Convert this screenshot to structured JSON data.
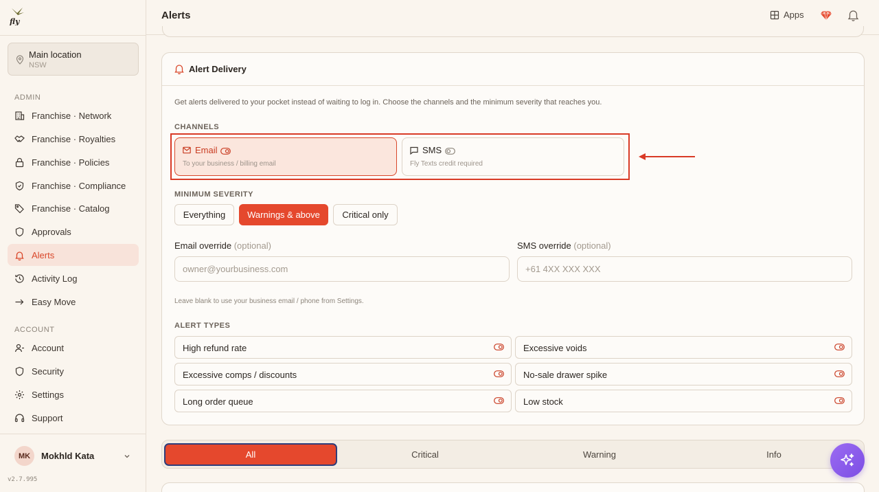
{
  "sidebar": {
    "location": {
      "name": "Main location",
      "region": "NSW"
    },
    "admin_label": "ADMIN",
    "admin_items": [
      {
        "label": "Franchise · Network",
        "icon": "building-icon"
      },
      {
        "label": "Franchise · Royalties",
        "icon": "handshake-icon"
      },
      {
        "label": "Franchise · Policies",
        "icon": "lock-icon"
      },
      {
        "label": "Franchise · Compliance",
        "icon": "shield-icon"
      },
      {
        "label": "Franchise · Catalog",
        "icon": "tag-icon"
      },
      {
        "label": "Approvals",
        "icon": "shield-check-icon"
      },
      {
        "label": "Alerts",
        "icon": "bell-icon"
      },
      {
        "label": "Activity Log",
        "icon": "history-icon"
      },
      {
        "label": "Easy Move",
        "icon": "arrow-right-icon"
      }
    ],
    "account_label": "ACCOUNT",
    "account_items": [
      {
        "label": "Account",
        "icon": "user-icon"
      },
      {
        "label": "Security",
        "icon": "shield-icon"
      },
      {
        "label": "Settings",
        "icon": "gear-icon"
      },
      {
        "label": "Support",
        "icon": "headset-icon"
      }
    ],
    "user": {
      "initials": "MK",
      "name": "Mokhld Kata"
    },
    "version": "v2.7.995"
  },
  "topbar": {
    "title": "Alerts",
    "apps_label": "Apps"
  },
  "alert_delivery": {
    "title": "Alert Delivery",
    "description": "Get alerts delivered to your pocket instead of waiting to log in. Choose the channels and the minimum severity that reaches you.",
    "channels_label": "CHANNELS",
    "channels": [
      {
        "name": "Email",
        "sub": "To your business / billing email",
        "enabled": true
      },
      {
        "name": "SMS",
        "sub": "Fly Texts credit required",
        "enabled": false
      }
    ],
    "severity_label": "MINIMUM SEVERITY",
    "severity_options": [
      "Everything",
      "Warnings & above",
      "Critical only"
    ],
    "severity_selected": "Warnings & above",
    "email_override": {
      "label": "Email override",
      "optional": "(optional)",
      "placeholder": "owner@yourbusiness.com"
    },
    "sms_override": {
      "label": "SMS override",
      "optional": "(optional)",
      "placeholder": "+61 4XX XXX XXX"
    },
    "override_hint": "Leave blank to use your business email / phone from Settings.",
    "types_label": "ALERT TYPES",
    "types": [
      "High refund rate",
      "Excessive voids",
      "Excessive comps / discounts",
      "No-sale drawer spike",
      "Long order queue",
      "Low stock"
    ]
  },
  "filter_tabs": [
    "All",
    "Critical",
    "Warning",
    "Info"
  ],
  "filter_selected": "All",
  "colors": {
    "accent": "#e5482d",
    "highlight": "#d93a26",
    "fab": "#8b5cf6"
  }
}
